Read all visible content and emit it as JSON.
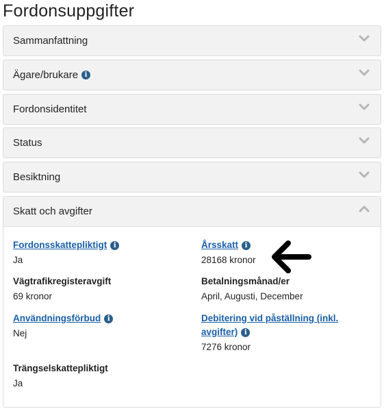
{
  "page_title": "Fordonsuppgifter",
  "panels": [
    {
      "title": "Sammanfattning",
      "info": false
    },
    {
      "title": "Ägare/brukare",
      "info": true
    },
    {
      "title": "Fordonsidentitet",
      "info": false
    },
    {
      "title": "Status",
      "info": false
    },
    {
      "title": "Besiktning",
      "info": false
    },
    {
      "title": "Skatt och avgifter",
      "info": false,
      "expanded": true
    }
  ],
  "tax_section": {
    "fordonsskattepliktigt": {
      "label": "Fordonsskattepliktigt",
      "value": "Ja"
    },
    "arsskatt": {
      "label": "Årsskatt",
      "value": "28168 kronor"
    },
    "vagtrafikregisteravgift": {
      "label": "Vägtrafikregisteravgift",
      "value": "69 kronor"
    },
    "betalningsmanad": {
      "label": "Betalningsmånad/er",
      "value": "April, Augusti, December"
    },
    "anvandningsforbud": {
      "label": "Användningsförbud",
      "value": "Nej"
    },
    "debitering": {
      "label_line1": "Debitering vid påställning (inkl.",
      "label_line2": "avgifter)",
      "value": "7276 kronor"
    },
    "trangselskattepliktigt": {
      "label": "Trängselskattepliktigt",
      "value": "Ja"
    }
  },
  "icons": {
    "info": "info-icon",
    "chevron_down": "chevron-down-icon",
    "chevron_up": "chevron-up-icon",
    "arrow": "arrow-left-icon"
  },
  "colors": {
    "link": "#1a5fa8",
    "info_icon": "#2b5f8a",
    "panel_bg": "#f2f2f2",
    "border": "#dcdcdc"
  }
}
